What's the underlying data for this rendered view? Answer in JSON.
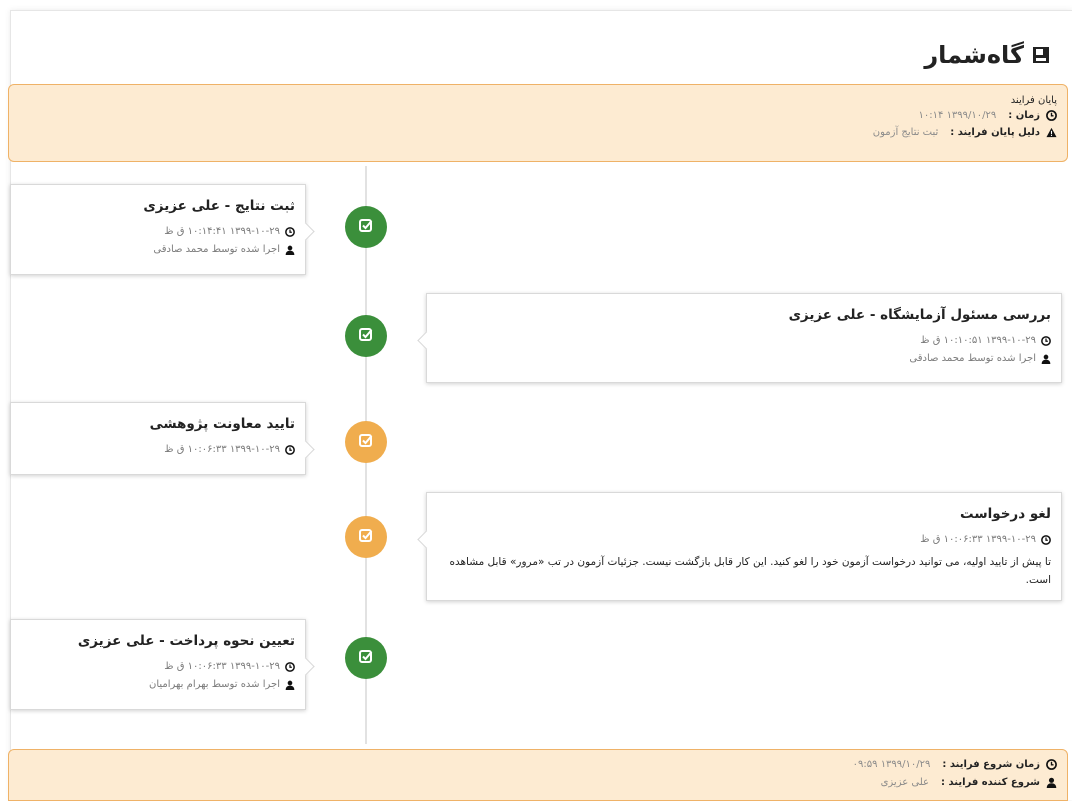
{
  "header": {
    "title": "گاه‌شمار",
    "title_icon": "timeline-icon"
  },
  "end_box": {
    "heading": "پایان فرایند",
    "time_label": "زمان :",
    "time_value": "۱۳۹۹/۱۰/۲۹ ۱۰:۱۴",
    "reason_label": "دلیل پایان فرایند :",
    "reason_value": "ثبت نتایج آزمون"
  },
  "events": [
    {
      "title": "ثبت نتایج - علی عزیزی",
      "time": "۱۳۹۹-۱۰-۲۹ ۱۰:۱۴:۴۱ ق ظ",
      "performer": "اجرا شده توسط محمد صادقی",
      "status": "green",
      "side": "left"
    },
    {
      "title": "بررسی مسئول آزمایشگاه - علی عزیزی",
      "time": "۱۳۹۹-۱۰-۲۹ ۱۰:۱۰:۵۱ ق ظ",
      "performer": "اجرا شده توسط محمد صادقی",
      "status": "green",
      "side": "right"
    },
    {
      "title": "تایید معاونت پژوهشی",
      "time": "۱۳۹۹-۱۰-۲۹ ۱۰:۰۶:۳۳ ق ظ",
      "status": "orange",
      "side": "left"
    },
    {
      "title": "لغو درخواست",
      "time": "۱۳۹۹-۱۰-۲۹ ۱۰:۰۶:۳۳ ق ظ",
      "description": "تا پیش از تایید اولیه، می توانید درخواست آزمون خود را لغو کنید. این کار قابل بازگشت نیست. جزئیات آزمون در تب «مرور» قابل مشاهده است.",
      "status": "orange",
      "side": "right"
    },
    {
      "title": "تعیین نحوه پرداخت - علی عزیزی",
      "time": "۱۳۹۹-۱۰-۲۹ ۱۰:۰۶:۳۳ ق ظ",
      "performer": "اجرا شده توسط بهرام بهرامیان",
      "status": "green",
      "side": "left"
    }
  ],
  "start_box": {
    "start_time_label": "زمان شروع فرایند :",
    "start_time_value": "۱۳۹۹/۱۰/۲۹ ۰۹:۵۹",
    "starter_label": "شروع کننده فرایند :",
    "starter_value": "علی عزیزی"
  },
  "colors": {
    "green": "#3b8f3b",
    "orange": "#f0ad4e",
    "box_bg": "#fdebd2",
    "box_border": "#efb267"
  },
  "icons": {
    "clock": "clock-icon",
    "warning": "warning-icon",
    "user": "user-icon",
    "check": "checkbox-check-icon"
  }
}
